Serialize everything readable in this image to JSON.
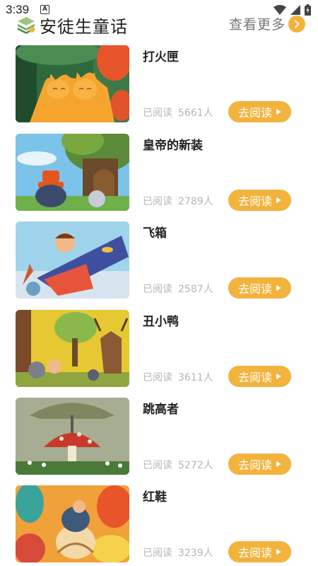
{
  "status": {
    "time": "3:39",
    "notification_glyph": "A"
  },
  "header": {
    "title": "安徒生童话",
    "more_label": "查看更多"
  },
  "colors": {
    "accent": "#f2b33d",
    "muted": "#b5b5b5"
  },
  "stories": [
    {
      "title": "打火匣",
      "read_label": "已阅读",
      "count": "5661人",
      "button": "去阅读"
    },
    {
      "title": "皇帝的新装",
      "read_label": "已阅读",
      "count": "2789人",
      "button": "去阅读"
    },
    {
      "title": "飞箱",
      "read_label": "已阅读",
      "count": "2587人",
      "button": "去阅读"
    },
    {
      "title": "丑小鸭",
      "read_label": "已阅读",
      "count": "3611人",
      "button": "去阅读"
    },
    {
      "title": "跳高者",
      "read_label": "已阅读",
      "count": "5272人",
      "button": "去阅读"
    },
    {
      "title": "红鞋",
      "read_label": "已阅读",
      "count": "3239人",
      "button": "去阅读"
    }
  ]
}
